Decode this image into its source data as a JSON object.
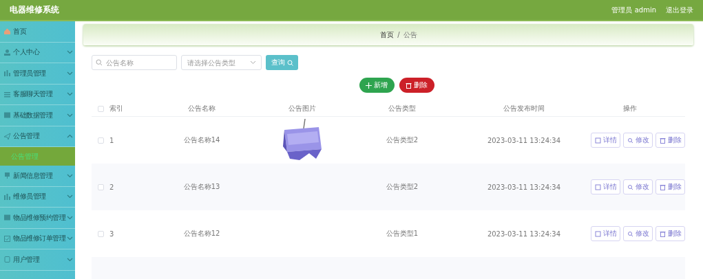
{
  "header": {
    "title": "电器维修系统",
    "user": "管理员 admin",
    "logout": "退出登录"
  },
  "sidebar": {
    "items": [
      {
        "label": "首页"
      },
      {
        "label": "个人中心",
        "expanded": false
      },
      {
        "label": "管理员管理",
        "expanded": false
      },
      {
        "label": "客服聊天管理",
        "expanded": false
      },
      {
        "label": "基础数据管理",
        "expanded": false
      },
      {
        "label": "公告管理",
        "expanded": true,
        "children": [
          {
            "label": "公告管理",
            "selected": true
          }
        ]
      },
      {
        "label": "新闻信息管理",
        "expanded": false
      },
      {
        "label": "维修员管理",
        "expanded": false
      },
      {
        "label": "物品维修预约管理",
        "expanded": false
      },
      {
        "label": "物品维修订单管理",
        "expanded": false
      },
      {
        "label": "用户管理",
        "expanded": false
      }
    ]
  },
  "breadcrumb": {
    "items": [
      "首页",
      "公告"
    ],
    "separator": "/"
  },
  "search": {
    "name_placeholder": "公告名称",
    "type_placeholder": "请选择公告类型",
    "query_button": "查询"
  },
  "actions": {
    "add": "新增",
    "delete": "删除"
  },
  "table": {
    "all_checked": false,
    "columns": [
      "索引",
      "公告名称",
      "公告图片",
      "公告类型",
      "公告发布时间",
      "操作"
    ],
    "rows": [
      {
        "index": "1",
        "name": "公告名称14",
        "type": "公告类型2",
        "time": "2023-03-11 13:24:34",
        "checked": false,
        "buttons": [
          "详情",
          "修改",
          "删除"
        ]
      },
      {
        "index": "2",
        "name": "公告名称13",
        "type": "公告类型2",
        "time": "2023-03-11 13:24:34",
        "checked": false,
        "buttons": [
          "详情",
          "修改",
          "删除"
        ]
      },
      {
        "index": "3",
        "name": "公告名称12",
        "type": "公告类型1",
        "time": "2023-03-11 13:24:34",
        "checked": false,
        "buttons": [
          "详情",
          "修改",
          "删除"
        ]
      }
    ]
  }
}
